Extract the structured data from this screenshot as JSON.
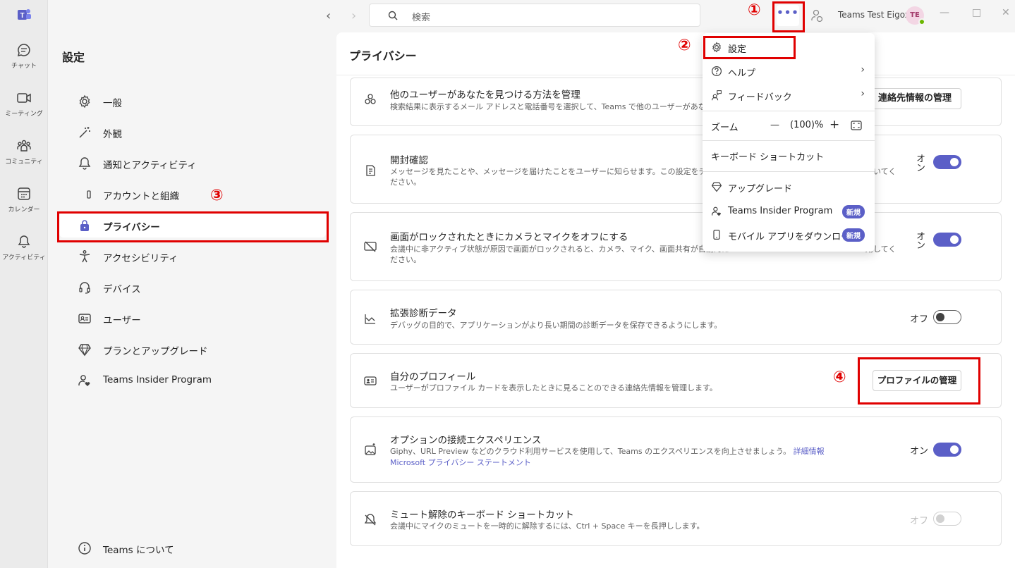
{
  "rail": {
    "items": [
      {
        "label": "チャット",
        "icon": "chat-icon"
      },
      {
        "label": "ミーティング",
        "icon": "video-icon"
      },
      {
        "label": "コミュニティ",
        "icon": "people-icon"
      },
      {
        "label": "カレンダー",
        "icon": "calendar-icon"
      },
      {
        "label": "アクティビティ",
        "icon": "bell-icon"
      }
    ]
  },
  "topbar": {
    "search_placeholder": "検索",
    "more_label": "•••",
    "user_name": "Teams Test Eigox",
    "avatar_initials": "TE"
  },
  "settings": {
    "title": "設定",
    "nav": [
      {
        "label": "一般",
        "icon": "gear-icon"
      },
      {
        "label": "外観",
        "icon": "wand-icon"
      },
      {
        "label": "通知とアクティビティ",
        "icon": "bell-icon"
      },
      {
        "label": "アカウントと組織",
        "icon": "account-icon"
      },
      {
        "label": "プライバシー",
        "icon": "lock-icon"
      },
      {
        "label": "アクセシビリティ",
        "icon": "accessibility-icon"
      },
      {
        "label": "デバイス",
        "icon": "headset-icon"
      },
      {
        "label": "ユーザー",
        "icon": "contact-card-icon"
      },
      {
        "label": "プランとアップグレード",
        "icon": "diamond-icon"
      },
      {
        "label": "Teams Insider Program",
        "icon": "person-heart-icon"
      }
    ],
    "about": "Teams について"
  },
  "privacy": {
    "title": "プライバシー",
    "cards": [
      {
        "title": "他のユーザーがあなたを見つける方法を管理",
        "desc": "検索結果に表示するメール アドレスと電話番号を選択して、Teams で他のユーザーがあなたのプ",
        "button": "連絡先情報の管理"
      },
      {
        "title": "開封確認",
        "desc": "メッセージを見たことや、メッセージを届けたことをユーザーに知らせます。この設定をチャット中に有効",
        "desc2": "開いてく",
        "desc3": "ださい。",
        "state": "オン"
      },
      {
        "title": "画面がロックされたときにカメラとマイクをオフにする",
        "desc": "会議中に非アクティブ状態が原因で画面がロックされると、カメラ、マイク、画面共有が自動的に",
        "desc2": "用してく",
        "desc3": "ださい。",
        "state": "オン"
      },
      {
        "title": "拡張診断データ",
        "desc": "デバッグの目的で、アプリケーションがより長い期間の診断データを保存できるようにします。",
        "state": "オフ"
      },
      {
        "title": "自分のプロフィール",
        "desc": "ユーザーがプロファイル カードを表示したときに見ることのできる連絡先情報を管理します。",
        "button": "プロファイルの管理"
      },
      {
        "title": "オプションの接続エクスペリエンス",
        "desc": "Giphy、URL Preview などのクラウド利用サービスを使用して、Teams のエクスペリエンスを向上させましょう。",
        "link1": "詳細情報",
        "link2": "Microsoft プライバシー ステートメント",
        "state": "オン"
      },
      {
        "title": "ミュート解除のキーボード ショートカット",
        "desc": "会議中にマイクのミュートを一時的に解除するには、Ctrl + Space キーを長押しします。",
        "state": "オフ"
      }
    ]
  },
  "dropdown": {
    "settings": "設定",
    "help": "ヘルプ",
    "feedback": "フィードバック",
    "zoom_label": "ズーム",
    "zoom_minus": "—",
    "zoom_value": "(100)%",
    "zoom_plus": "+",
    "shortcuts": "キーボード ショートカット",
    "upgrade": "アップグレード",
    "insider": "Teams Insider Program",
    "insider_badge": "新規",
    "mobile": "モバイル アプリをダウンロード",
    "mobile_badge": "新規"
  },
  "annotations": {
    "n1": "①",
    "n2": "②",
    "n3": "③",
    "n4": "④",
    "color": "#e00000"
  },
  "colors": {
    "accent": "#5b5fc7",
    "annotation": "#e00000"
  }
}
